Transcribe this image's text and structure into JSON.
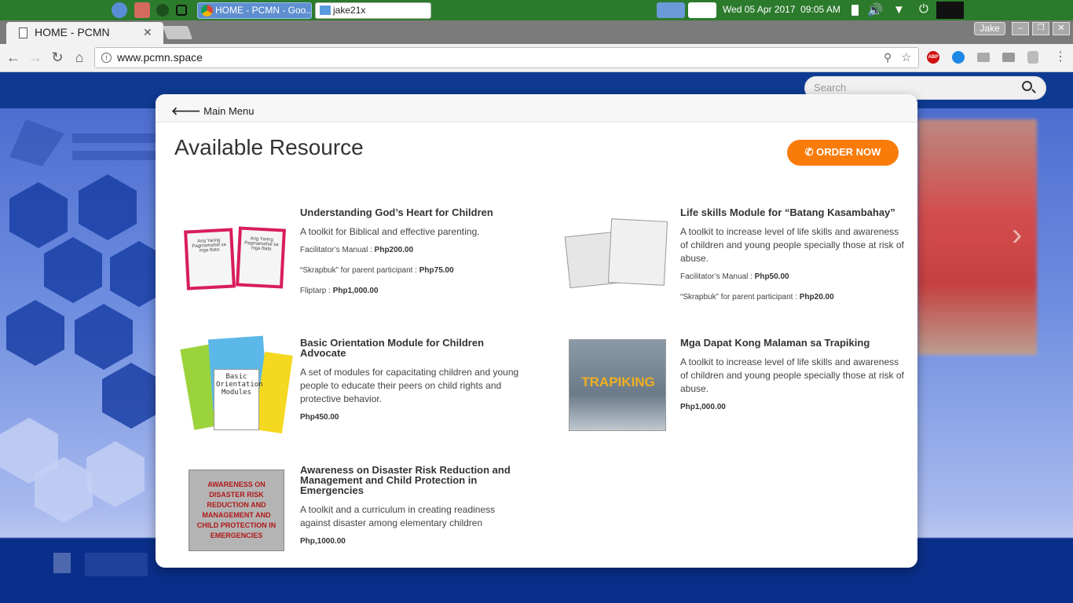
{
  "taskbar": {
    "tasks": [
      "HOME - PCMN - Goo...",
      "jake21x"
    ],
    "clock": "Wed 05 Apr 2017  09:05 AM"
  },
  "browser": {
    "tab_title": "HOME - PCMN",
    "url": "www.pcmn.space",
    "user": "Jake"
  },
  "site": {
    "search_placeholder": "Search",
    "menu_link": "Main Menu",
    "heading": "Available Resource",
    "order_button": "ORDER NOW"
  },
  "resources": [
    {
      "title": "Understanding God’s Heart for Children",
      "desc": "A toolkit for Biblical and effective parenting.",
      "prices": [
        {
          "label": "Facilitator’s Manual : ",
          "value": "Php200.00"
        },
        {
          "label": "“Skrapbuk” for parent participant : ",
          "value": "Php75.00"
        },
        {
          "label": "Fliptarp : ",
          "value": "Php1,000.00"
        }
      ]
    },
    {
      "title": "Life skills Module for “Batang Kasambahay”",
      "desc": " A toolkit to increase level of life skills and awareness of children and young people specially those at risk of abuse.",
      "prices": [
        {
          "label": " Facilitator’s Manual : ",
          "value": "Php50.00"
        },
        {
          "label": "“Skrapbuk” for parent participant : ",
          "value": "Php20.00"
        }
      ]
    },
    {
      "title": "Basic Orientation Module for Children Advocate",
      "desc": " A set of modules for capacitating children and young people to educate their peers on child rights and protective behavior.",
      "prices": [
        {
          "label": "",
          "value": "Php450.00"
        }
      ]
    },
    {
      "title": "Mga Dapat Kong Malaman sa Trapiking",
      "desc": " A toolkit to increase level of life skills and awareness of children and young people specially those at risk of abuse.",
      "prices": [
        {
          "label": " ",
          "value": "Php1,000.00"
        }
      ]
    },
    {
      "title": "Awareness on Disaster Risk Reduction and Management and Child Protection in Emergencies",
      "desc": "A toolkit and a curriculum in creating readiness against disaster among elementary children",
      "prices": [
        {
          "label": "",
          "value": "Php,1000.00"
        }
      ]
    }
  ],
  "thumbnails": {
    "book1": "Ang Yaring Pagmamahal sa mga Bata",
    "book3": "Basic Orientation Modules",
    "book4": "TRAPIKING",
    "book5": "AWARENESS ON DISASTER RISK REDUCTION AND MANAGEMENT AND CHILD PROTECTION IN EMERGENCIES"
  },
  "colors": {
    "accent": "#f97b0a",
    "taskbar": "#2c7a2c"
  },
  "icons": [
    "search-icon",
    "phone-icon",
    "arrow-left-icon",
    "reload-icon",
    "home-icon",
    "star-icon",
    "zoom-icon",
    "menu-icon"
  ]
}
